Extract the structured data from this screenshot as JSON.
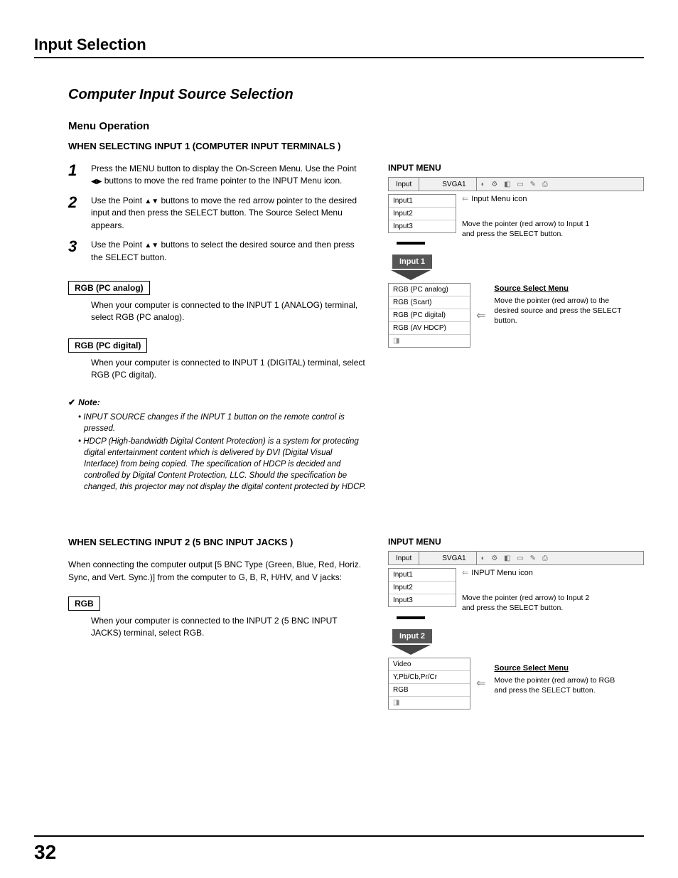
{
  "header": {
    "title": "Input Selection"
  },
  "section": {
    "title": "Computer Input Source Selection",
    "subtitle": "Menu Operation"
  },
  "input1": {
    "heading": "WHEN SELECTING INPUT 1 (COMPUTER INPUT TERMINALS )",
    "steps": {
      "s1_a": "Press the MENU button to display the On-Screen Menu. Use the Point ",
      "s1_b": " buttons to move the red frame pointer to the INPUT Menu icon.",
      "s2_a": "Use the Point ",
      "s2_b": " buttons to move the red arrow pointer to the desired input and then press the SELECT button. The Source Select Menu appears.",
      "s3_a": "Use the Point ",
      "s3_b": " buttons to select the desired source and then press the SELECT button."
    },
    "box1": {
      "label": "RGB (PC analog)",
      "desc": "When your computer is connected to the INPUT 1 (ANALOG) terminal, select RGB (PC analog)."
    },
    "box2": {
      "label": "RGB (PC digital)",
      "desc": "When your computer is connected to INPUT 1 (DIGITAL) terminal, select RGB (PC digital)."
    },
    "note": {
      "head": "Note:",
      "items": [
        "INPUT SOURCE changes if the INPUT 1 button on the remote control is pressed.",
        "HDCP (High-bandwidth Digital Content Protection) is a system for protecting digital entertainment content which is delivered by DVI (Digital Visual Interface) from being copied. The specification of HDCP is decided and controlled by Digital Content Protection, LLC. Should the specification be changed, this projector may not display the digital content protected by HDCP."
      ]
    },
    "menu": {
      "title": "INPUT MENU",
      "bar": {
        "label": "Input",
        "mode": "SVGA1",
        "icons": "◐ ⚙ ◧ ▭ ✎ ⎙"
      },
      "rows": [
        "Input1",
        "Input2",
        "Input3"
      ],
      "icon_label": "Input Menu icon",
      "callout": "Move the pointer (red arrow) to Input 1 and press the SELECT button.",
      "chip": "Input 1",
      "source_title": "Source Select Menu",
      "source_rows": [
        "RGB (PC analog)",
        "RGB (Scart)",
        "RGB (PC digital)",
        "RGB (AV HDCP)",
        "◨"
      ],
      "source_callout": "Move the pointer (red arrow) to the desired source and press the SELECT button."
    }
  },
  "input2": {
    "heading": "WHEN SELECTING INPUT 2 (5 BNC INPUT JACKS )",
    "intro": "When connecting the computer output [5 BNC Type (Green, Blue, Red, Horiz. Sync, and Vert. Sync.)] from the computer to G, B, R, H/HV, and V jacks:",
    "box": {
      "label": "RGB",
      "desc": "When your computer is connected to the INPUT 2 (5 BNC INPUT JACKS) terminal, select RGB."
    },
    "menu": {
      "title": "INPUT MENU",
      "bar": {
        "label": "Input",
        "mode": "SVGA1",
        "icons": "◐ ⚙ ◧ ▭ ✎ ⎙"
      },
      "rows": [
        "Input1",
        "Input2",
        "Input3"
      ],
      "icon_label": "INPUT Menu icon",
      "callout": "Move the pointer (red arrow) to Input 2 and press the SELECT button.",
      "chip": "Input 2",
      "source_title": "Source Select Menu",
      "source_rows": [
        "Video",
        "Y,Pb/Cb,Pr/Cr",
        "RGB",
        "◨"
      ],
      "source_callout": "Move the pointer (red arrow) to RGB and press the SELECT button."
    }
  },
  "footer": {
    "page": "32"
  }
}
